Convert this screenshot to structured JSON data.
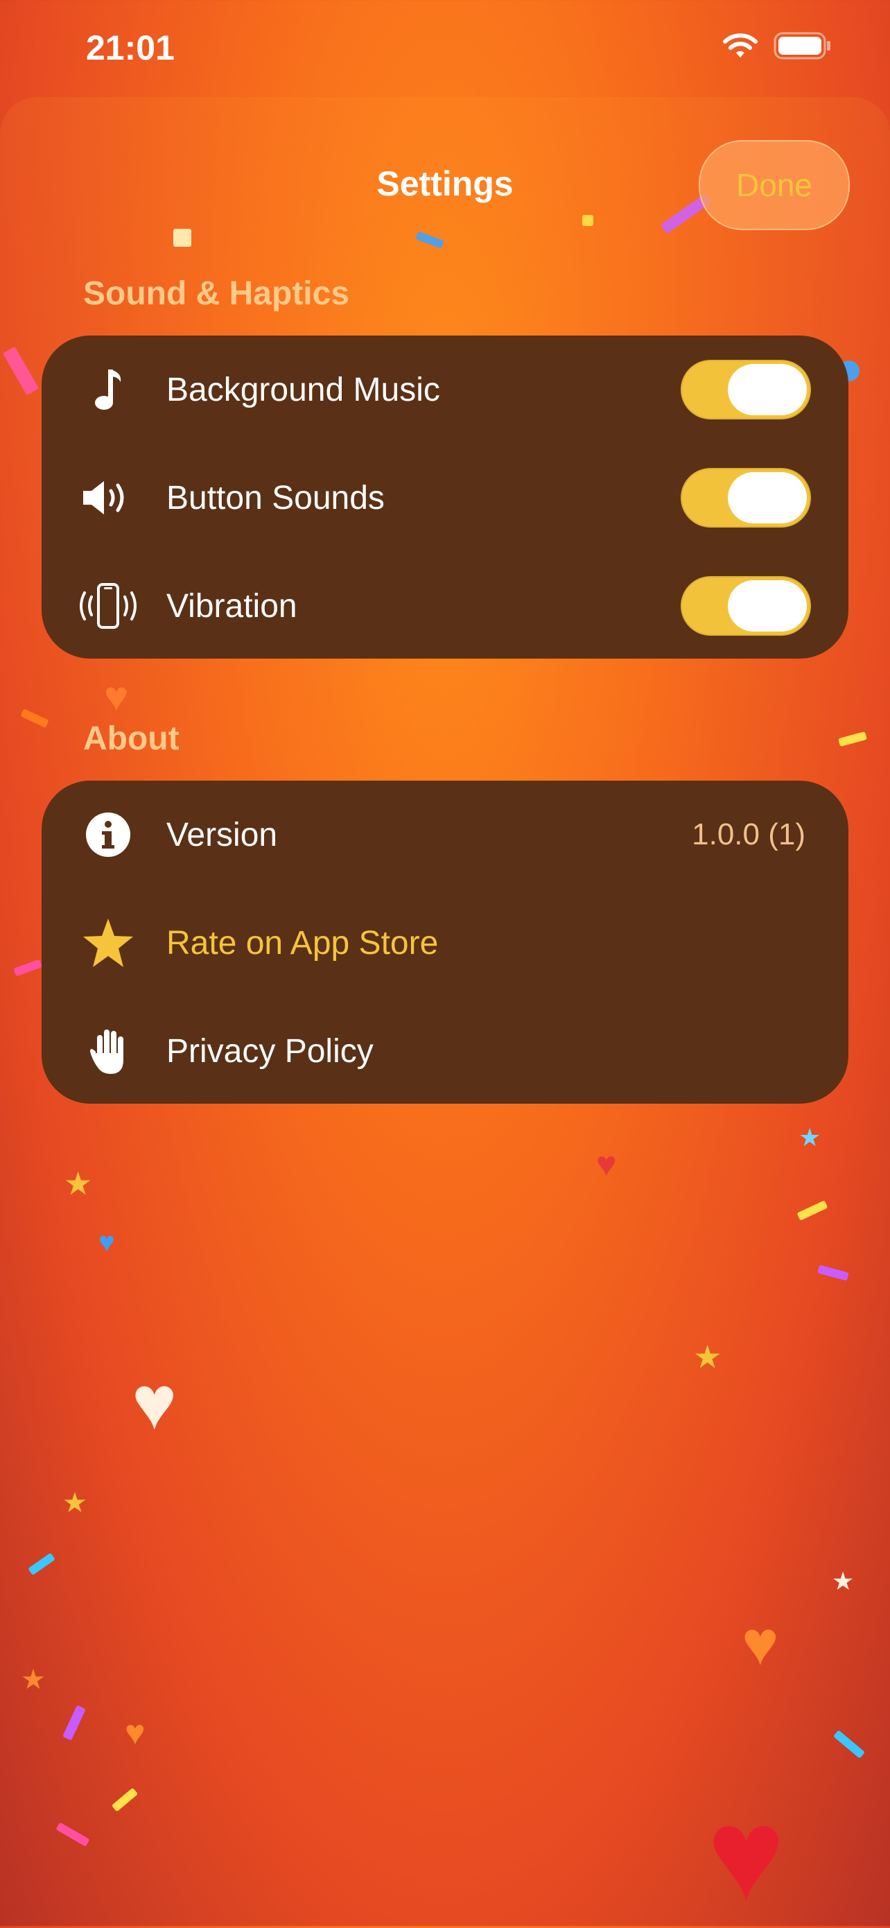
{
  "status_bar": {
    "time": "21:01"
  },
  "header": {
    "title": "Settings",
    "done_label": "Done"
  },
  "sections": [
    {
      "title": "Sound & Haptics",
      "rows": [
        {
          "icon": "music-note-icon",
          "label": "Background Music",
          "toggle_on": true
        },
        {
          "icon": "speaker-icon",
          "label": "Button Sounds",
          "toggle_on": true
        },
        {
          "icon": "phone-vibrate-icon",
          "label": "Vibration",
          "toggle_on": true
        }
      ]
    },
    {
      "title": "About",
      "rows": [
        {
          "icon": "info-icon",
          "label": "Version",
          "value": "1.0.0 (1)"
        },
        {
          "icon": "star-icon",
          "label": "Rate on App Store"
        },
        {
          "icon": "hand-icon",
          "label": "Privacy Policy"
        }
      ]
    }
  ],
  "colors": {
    "card": "#5a3116",
    "toggle_on": "#f2c23a",
    "accent": "#f6c43a",
    "section_header": "#ffc98a"
  }
}
